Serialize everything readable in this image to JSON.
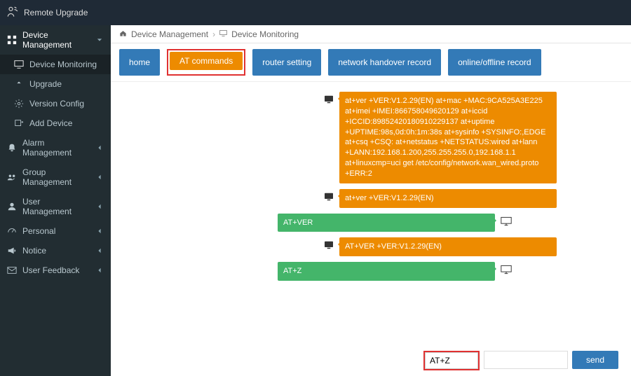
{
  "app": {
    "title": "Remote Upgrade"
  },
  "sidebar": {
    "device_mgmt": "Device Management",
    "device_monitoring": "Device Monitoring",
    "upgrade": "Upgrade",
    "version_config": "Version Config",
    "add_device": "Add Device",
    "alarm_mgmt": "Alarm Management",
    "group_mgmt": "Group Management",
    "user_mgmt": "User Management",
    "personal": "Personal",
    "notice": "Notice",
    "user_feedback": "User Feedback"
  },
  "breadcrumb": {
    "root": "Device Management",
    "current": "Device Monitoring"
  },
  "tabs": {
    "home": "home",
    "at_commands": "AT commands",
    "router_setting": "router setting",
    "network_handover": "network handover record",
    "online_offline": "online/offline record"
  },
  "messages": {
    "m1": "at+ver +VER:V1.2.29(EN) at+mac +MAC:9CA525A3E225 at+imei +IMEI:866758049620129 at+iccid +ICCID:89852420180910229137 at+uptime +UPTIME:98s,0d:0h:1m:38s at+sysinfo +SYSINFO:,EDGE at+csq +CSQ: at+netstatus +NETSTATUS:wired at+lann +LANN:192.168.1.200,255.255.255.0,192.168.1.1 at+linuxcmp=uci get /etc/config/network.wan_wired.proto +ERR:2",
    "m2": "at+ver +VER:V1.2.29(EN)",
    "m3": "AT+VER",
    "m4": "AT+VER +VER:V1.2.29(EN)",
    "m5": "AT+Z"
  },
  "input": {
    "value": "AT+Z",
    "send_label": "send"
  }
}
